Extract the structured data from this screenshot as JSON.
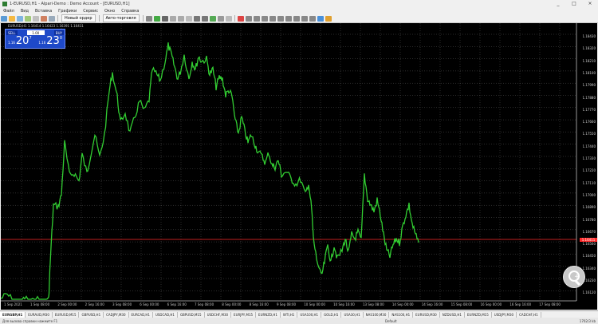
{
  "window": {
    "title": "1-EURUSD,H1 - Alpari-Demo : Demo Account - [EURUSD,H1]",
    "controls": [
      "_",
      "□",
      "×"
    ]
  },
  "menu": [
    "Файл",
    "Вид",
    "Вставка",
    "Графики",
    "Сервис",
    "Окно",
    "Справка"
  ],
  "toolbar": {
    "new_order_label": "Новый ордер",
    "autotrading_label": "Авто-торговля"
  },
  "chart": {
    "title": "EURUSD,H1 1.16414 1.16423 1.16391 1.16411",
    "trade_panel": {
      "sell_label": "SELL",
      "buy_label": "BUY",
      "lot": "1.00",
      "sell_prefix": "1.16",
      "sell_big": "20",
      "sell_sup": "7",
      "buy_prefix": "1.16",
      "buy_big": "23",
      "buy_sup": "0"
    },
    "current_price": "1.16411",
    "price_labels": [
      "1.18430",
      "1.18320",
      "1.18210",
      "1.18100",
      "1.17990",
      "1.17880",
      "1.17770",
      "1.17660",
      "1.17550",
      "1.17440",
      "1.17330",
      "1.17220",
      "1.17110",
      "1.17000",
      "1.16890",
      "1.16780",
      "1.16670",
      "1.16560",
      "1.16450",
      "1.16340",
      "1.16230",
      "1.16120"
    ],
    "time_labels": [
      "1 Sep 2021",
      "1 Sep 08:00",
      "2 Sep 00:00",
      "2 Sep 16:00",
      "3 Sep 08:00",
      "6 Sep 00:00",
      "6 Sep 16:00",
      "7 Sep 08:00",
      "8 Sep 00:00",
      "8 Sep 16:00",
      "9 Sep 08:00",
      "10 Sep 00:00",
      "10 Sep 16:00",
      "13 Sep 08:00",
      "14 Sep 00:00",
      "14 Sep 16:00",
      "15 Sep 08:00",
      "16 Sep 00:00",
      "16 Sep 16:00",
      "17 Sep 08:00"
    ],
    "line_color": "#32cd32",
    "price_line_color": "#ff2a2a",
    "background": "#000000"
  },
  "tabs": [
    "EURGBP,H1",
    "EURAUD,M30",
    "EURUSD,M15",
    "GBPUSD,H1",
    "CADJPY,M30",
    "EURCAD,H1",
    "USDCAD,H1",
    "GBPUSD,M15",
    "USDCHF,M30",
    "EURJPY,M15",
    "EURNZD,H1",
    "WTI,H1",
    "USA100,H1",
    "GOLD,H1",
    "USA30,H1",
    "NAS100,M30",
    "NAS100,H1",
    "EURUSD,M30",
    "NZDUSD,H1",
    "EURNZD,M15",
    "USDJPY,M30",
    "CADCHF,H1"
  ],
  "active_tab": 0,
  "statusbar": {
    "help": "Для вызова справки нажмите F1",
    "profile": "Default",
    "traffic": "1702/3 kb"
  }
}
